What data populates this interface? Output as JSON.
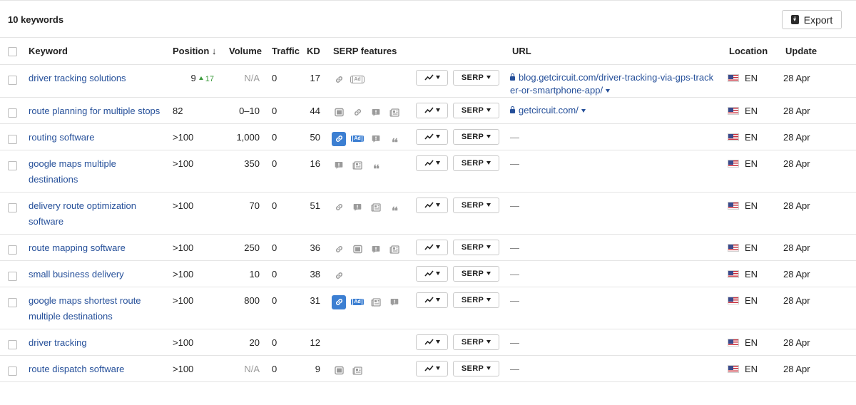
{
  "header": {
    "title": "10 keywords",
    "export_label": "Export"
  },
  "columns": {
    "keyword": "Keyword",
    "position": "Position",
    "position_sort_indicator": "↓",
    "volume": "Volume",
    "traffic": "Traffic",
    "kd": "KD",
    "serp_features": "SERP features",
    "url": "URL",
    "location": "Location",
    "update": "Update"
  },
  "serp_button_label": "SERP",
  "rows": [
    {
      "keyword": "driver tracking solutions",
      "position": "9",
      "position_change": "17",
      "volume": "N/A",
      "traffic": "0",
      "kd": "17",
      "serp": [
        {
          "icon": "link",
          "active": false
        },
        {
          "icon": "ad",
          "active": false
        }
      ],
      "url": "blog.getcircuit.com/driver-tracking-via-gps-tracker-or-smartphone-app/",
      "location": "EN",
      "update": "28 Apr"
    },
    {
      "keyword": "route planning for multiple stops",
      "position": "82",
      "position_change": "",
      "volume": "0–10",
      "traffic": "0",
      "kd": "44",
      "serp": [
        {
          "icon": "image",
          "active": false
        },
        {
          "icon": "link",
          "active": false
        },
        {
          "icon": "faq",
          "active": false
        },
        {
          "icon": "news",
          "active": false
        }
      ],
      "url": "getcircuit.com/",
      "location": "EN",
      "update": "28 Apr"
    },
    {
      "keyword": "routing software",
      "position": ">100",
      "position_change": "",
      "volume": "1,000",
      "traffic": "0",
      "kd": "50",
      "serp": [
        {
          "icon": "link",
          "active": true
        },
        {
          "icon": "ad",
          "active": true
        },
        {
          "icon": "faq",
          "active": false
        },
        {
          "icon": "quote",
          "active": false
        }
      ],
      "url": "",
      "location": "EN",
      "update": "28 Apr"
    },
    {
      "keyword": "google maps multiple destinations",
      "position": ">100",
      "position_change": "",
      "volume": "350",
      "traffic": "0",
      "kd": "16",
      "serp": [
        {
          "icon": "faq",
          "active": false
        },
        {
          "icon": "news",
          "active": false
        },
        {
          "icon": "quote",
          "active": false
        }
      ],
      "url": "",
      "location": "EN",
      "update": "28 Apr"
    },
    {
      "keyword": "delivery route optimization software",
      "position": ">100",
      "position_change": "",
      "volume": "70",
      "traffic": "0",
      "kd": "51",
      "serp": [
        {
          "icon": "link",
          "active": false
        },
        {
          "icon": "faq",
          "active": false
        },
        {
          "icon": "news",
          "active": false
        },
        {
          "icon": "quote",
          "active": false
        }
      ],
      "url": "",
      "location": "EN",
      "update": "28 Apr"
    },
    {
      "keyword": "route mapping software",
      "position": ">100",
      "position_change": "",
      "volume": "250",
      "traffic": "0",
      "kd": "36",
      "serp": [
        {
          "icon": "link",
          "active": false
        },
        {
          "icon": "image",
          "active": false
        },
        {
          "icon": "faq",
          "active": false
        },
        {
          "icon": "news",
          "active": false
        }
      ],
      "url": "",
      "location": "EN",
      "update": "28 Apr"
    },
    {
      "keyword": "small business delivery",
      "position": ">100",
      "position_change": "",
      "volume": "10",
      "traffic": "0",
      "kd": "38",
      "serp": [
        {
          "icon": "link",
          "active": false
        }
      ],
      "url": "",
      "location": "EN",
      "update": "28 Apr"
    },
    {
      "keyword": "google maps shortest route multiple destinations",
      "position": ">100",
      "position_change": "",
      "volume": "800",
      "traffic": "0",
      "kd": "31",
      "serp": [
        {
          "icon": "link",
          "active": true
        },
        {
          "icon": "ad",
          "active": true
        },
        {
          "icon": "news",
          "active": false
        },
        {
          "icon": "faq",
          "active": false
        }
      ],
      "url": "",
      "location": "EN",
      "update": "28 Apr"
    },
    {
      "keyword": "driver tracking",
      "position": ">100",
      "position_change": "",
      "volume": "20",
      "traffic": "0",
      "kd": "12",
      "serp": [],
      "url": "",
      "location": "EN",
      "update": "28 Apr"
    },
    {
      "keyword": "route dispatch software",
      "position": ">100",
      "position_change": "",
      "volume": "N/A",
      "traffic": "0",
      "kd": "9",
      "serp": [
        {
          "icon": "image",
          "active": false
        },
        {
          "icon": "news",
          "active": false
        }
      ],
      "url": "",
      "location": "EN",
      "update": "28 Apr"
    }
  ],
  "empty_url_placeholder": "—",
  "colors": {
    "link": "#26509a",
    "accent": "#3c7fd2",
    "positive": "#3a9a3a"
  }
}
